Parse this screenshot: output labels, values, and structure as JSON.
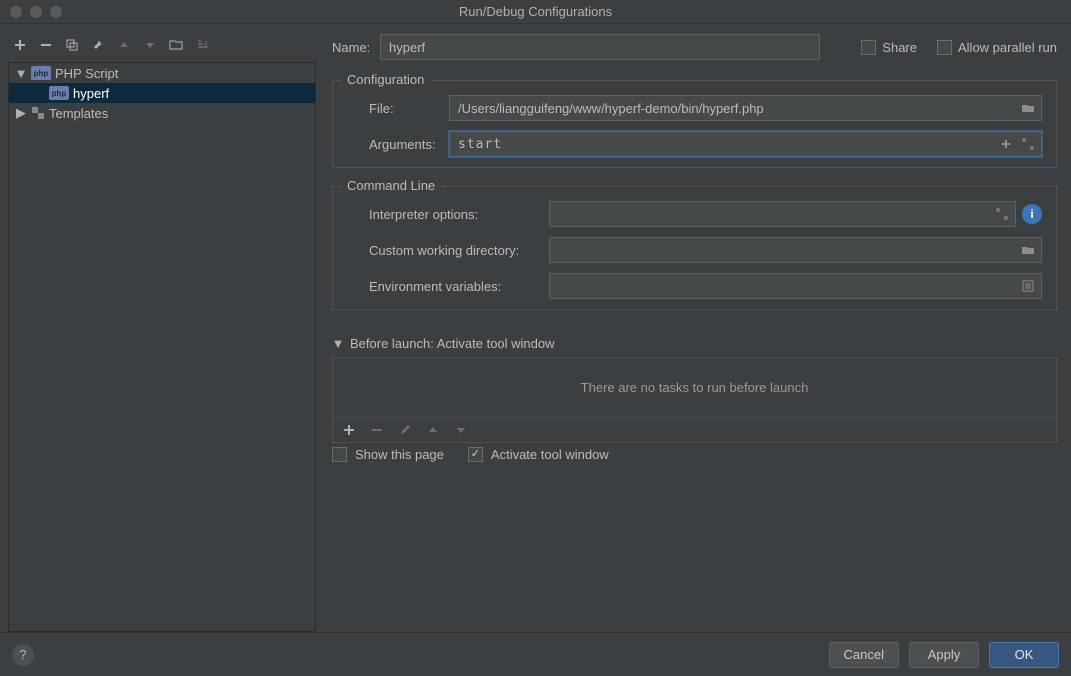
{
  "title": "Run/Debug Configurations",
  "tree": {
    "phpScript": "PHP Script",
    "hyperf": "hyperf",
    "templates": "Templates"
  },
  "form": {
    "nameLabel": "Name:",
    "nameValue": "hyperf",
    "share": "Share",
    "allowParallel": "Allow parallel run",
    "configuration": "Configuration",
    "fileLabel": "File:",
    "fileValue": "/Users/liangguifeng/www/hyperf-demo/bin/hyperf.php",
    "argumentsLabel": "Arguments:",
    "argumentsValue": "start",
    "commandLine": "Command Line",
    "interpreterOptions": "Interpreter options:",
    "customWorkingDir": "Custom working directory:",
    "envVars": "Environment variables:",
    "beforeLaunch": "Before launch: Activate tool window",
    "noTasks": "There are no tasks to run before launch",
    "showThisPage": "Show this page",
    "activateTool": "Activate tool window"
  },
  "buttons": {
    "cancel": "Cancel",
    "apply": "Apply",
    "ok": "OK"
  }
}
